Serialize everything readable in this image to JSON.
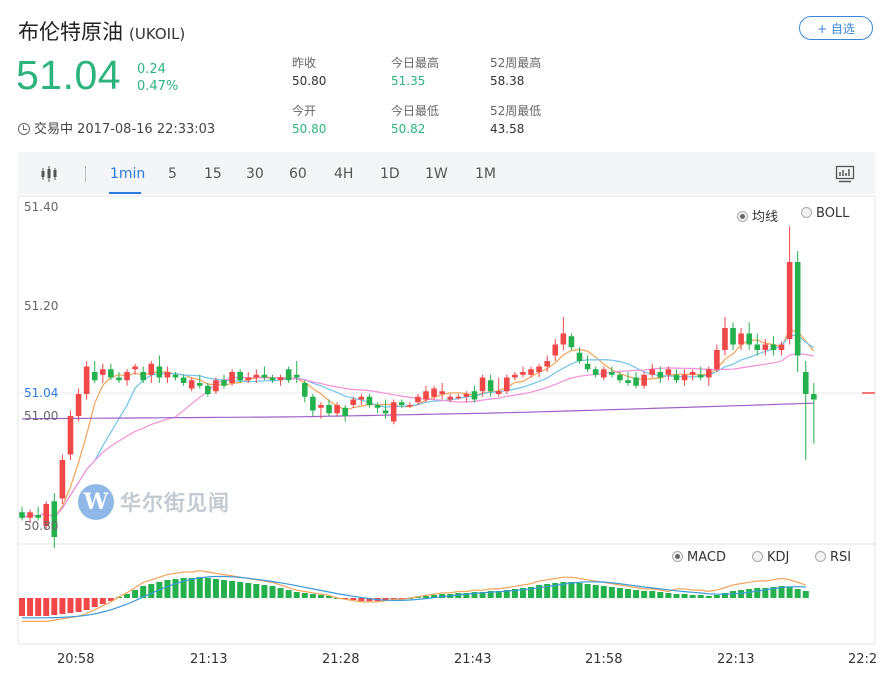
{
  "header": {
    "title": "布伦特原油",
    "code": "(UKOIL)",
    "add_button": "+ 自选",
    "price": "51.04",
    "change": "0.24",
    "change_pct": "0.47%",
    "status": "交易中 2017-08-16 22:33:03",
    "accent_color": "#2db37d"
  },
  "stats": {
    "prev_close_label": "昨收",
    "prev_close": "50.80",
    "open_label": "今开",
    "open": "50.80",
    "high_label": "今日最高",
    "high": "51.35",
    "low_label": "今日最低",
    "low": "50.82",
    "w52_high_label": "52周最高",
    "w52_high": "58.38",
    "w52_low_label": "52周最低",
    "w52_low": "43.58"
  },
  "toolbar": {
    "candle_icon": "candlestick-icon",
    "intervals": [
      "1min",
      "5",
      "15",
      "30",
      "60",
      "4H",
      "1D",
      "1W",
      "1M"
    ],
    "active_interval": "1min",
    "chart_icon": "chart-monitor-icon"
  },
  "main_chart": {
    "overlay_options": [
      "均线",
      "BOLL"
    ],
    "selected_overlay": "均线",
    "y_ticks": [
      "51.40",
      "51.20",
      "51.00",
      "50.80"
    ],
    "current_price_label": "51.04",
    "watermark_text": "华尔街见闻"
  },
  "sub_chart": {
    "indicator_options": [
      "MACD",
      "KDJ",
      "RSI"
    ],
    "selected_indicator": "MACD"
  },
  "x_ticks": [
    "20:58",
    "21:13",
    "21:28",
    "21:43",
    "21:58",
    "22:13",
    "22:2"
  ],
  "colors": {
    "up": "#f04848",
    "down": "#24b04c",
    "blue": "#2a7ae2"
  }
}
